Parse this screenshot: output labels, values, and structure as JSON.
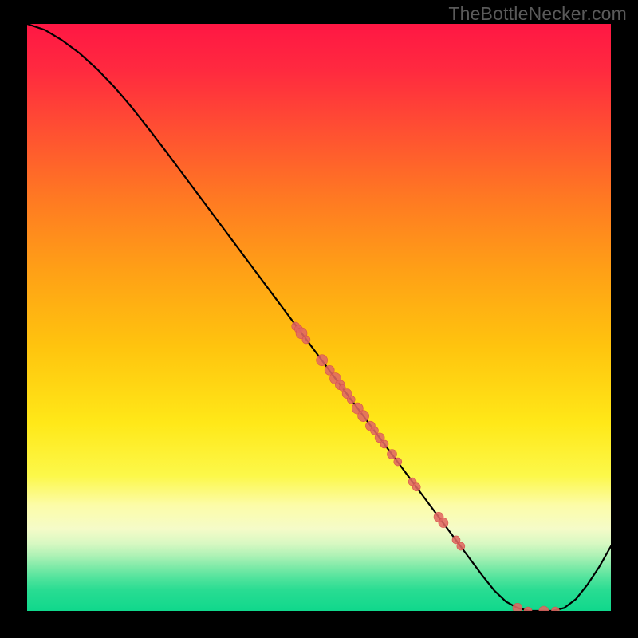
{
  "watermark": "TheBottleNecker.com",
  "colors": {
    "curve": "#000000",
    "point_fill": "#e06862",
    "point_stroke": "#d8524c",
    "gradient_stops": [
      {
        "offset": 0.0,
        "color": "#ff1744"
      },
      {
        "offset": 0.08,
        "color": "#ff2a3f"
      },
      {
        "offset": 0.18,
        "color": "#ff4f32"
      },
      {
        "offset": 0.3,
        "color": "#ff7a22"
      },
      {
        "offset": 0.42,
        "color": "#ffa016"
      },
      {
        "offset": 0.55,
        "color": "#ffc40e"
      },
      {
        "offset": 0.68,
        "color": "#ffe818"
      },
      {
        "offset": 0.77,
        "color": "#fcf84a"
      },
      {
        "offset": 0.82,
        "color": "#fcfca8"
      },
      {
        "offset": 0.86,
        "color": "#f5fbc8"
      },
      {
        "offset": 0.885,
        "color": "#d8f8c2"
      },
      {
        "offset": 0.905,
        "color": "#b0f2b6"
      },
      {
        "offset": 0.925,
        "color": "#7eeaa8"
      },
      {
        "offset": 0.945,
        "color": "#4fe39c"
      },
      {
        "offset": 0.965,
        "color": "#28dc92"
      },
      {
        "offset": 1.0,
        "color": "#10d88c"
      }
    ]
  },
  "chart_data": {
    "type": "line",
    "title": "",
    "xlabel": "",
    "ylabel": "",
    "xlim": [
      0,
      100
    ],
    "ylim": [
      0,
      100
    ],
    "curve": [
      {
        "x": 0,
        "y": 100.0
      },
      {
        "x": 3,
        "y": 99.0
      },
      {
        "x": 6,
        "y": 97.2
      },
      {
        "x": 9,
        "y": 95.0
      },
      {
        "x": 12,
        "y": 92.3
      },
      {
        "x": 15,
        "y": 89.2
      },
      {
        "x": 18,
        "y": 85.7
      },
      {
        "x": 21,
        "y": 81.9
      },
      {
        "x": 24,
        "y": 78.0
      },
      {
        "x": 27,
        "y": 74.0
      },
      {
        "x": 30,
        "y": 70.0
      },
      {
        "x": 33,
        "y": 66.0
      },
      {
        "x": 36,
        "y": 62.0
      },
      {
        "x": 39,
        "y": 58.0
      },
      {
        "x": 42,
        "y": 54.0
      },
      {
        "x": 45,
        "y": 50.0
      },
      {
        "x": 48,
        "y": 46.0
      },
      {
        "x": 51,
        "y": 42.0
      },
      {
        "x": 54,
        "y": 38.0
      },
      {
        "x": 57,
        "y": 34.0
      },
      {
        "x": 60,
        "y": 30.0
      },
      {
        "x": 63,
        "y": 26.0
      },
      {
        "x": 66,
        "y": 22.0
      },
      {
        "x": 69,
        "y": 18.0
      },
      {
        "x": 72,
        "y": 14.0
      },
      {
        "x": 75,
        "y": 10.0
      },
      {
        "x": 78,
        "y": 6.0
      },
      {
        "x": 80,
        "y": 3.5
      },
      {
        "x": 82,
        "y": 1.6
      },
      {
        "x": 84,
        "y": 0.5
      },
      {
        "x": 86,
        "y": 0.0
      },
      {
        "x": 88,
        "y": 0.0
      },
      {
        "x": 90,
        "y": 0.0
      },
      {
        "x": 92,
        "y": 0.5
      },
      {
        "x": 94,
        "y": 2.0
      },
      {
        "x": 96,
        "y": 4.5
      },
      {
        "x": 98,
        "y": 7.5
      },
      {
        "x": 100,
        "y": 11.0
      }
    ],
    "series": [
      {
        "name": "points",
        "values": [
          {
            "x": 46.0,
            "y": 48.5,
            "r": 5
          },
          {
            "x": 46.5,
            "y": 48.0,
            "r": 5
          },
          {
            "x": 47.0,
            "y": 47.3,
            "r": 7
          },
          {
            "x": 47.8,
            "y": 46.2,
            "r": 5
          },
          {
            "x": 50.5,
            "y": 42.7,
            "r": 7
          },
          {
            "x": 51.8,
            "y": 41.0,
            "r": 6
          },
          {
            "x": 52.8,
            "y": 39.6,
            "r": 7
          },
          {
            "x": 53.6,
            "y": 38.5,
            "r": 6
          },
          {
            "x": 54.0,
            "y": 38.0,
            "r": 4
          },
          {
            "x": 54.8,
            "y": 37.0,
            "r": 6
          },
          {
            "x": 55.5,
            "y": 36.0,
            "r": 5
          },
          {
            "x": 56.6,
            "y": 34.5,
            "r": 7
          },
          {
            "x": 57.6,
            "y": 33.2,
            "r": 7
          },
          {
            "x": 58.8,
            "y": 31.5,
            "r": 6
          },
          {
            "x": 59.5,
            "y": 30.7,
            "r": 5
          },
          {
            "x": 60.4,
            "y": 29.5,
            "r": 6
          },
          {
            "x": 61.2,
            "y": 28.4,
            "r": 5
          },
          {
            "x": 62.5,
            "y": 26.7,
            "r": 6
          },
          {
            "x": 63.5,
            "y": 25.4,
            "r": 5
          },
          {
            "x": 66.0,
            "y": 22.0,
            "r": 5
          },
          {
            "x": 66.7,
            "y": 21.1,
            "r": 5
          },
          {
            "x": 70.5,
            "y": 16.0,
            "r": 6
          },
          {
            "x": 71.3,
            "y": 15.0,
            "r": 6
          },
          {
            "x": 73.5,
            "y": 12.1,
            "r": 5
          },
          {
            "x": 74.3,
            "y": 11.0,
            "r": 5
          },
          {
            "x": 84.0,
            "y": 0.5,
            "r": 6
          },
          {
            "x": 85.8,
            "y": 0.0,
            "r": 5
          },
          {
            "x": 88.5,
            "y": 0.0,
            "r": 6
          },
          {
            "x": 90.5,
            "y": 0.0,
            "r": 5
          }
        ]
      }
    ]
  }
}
